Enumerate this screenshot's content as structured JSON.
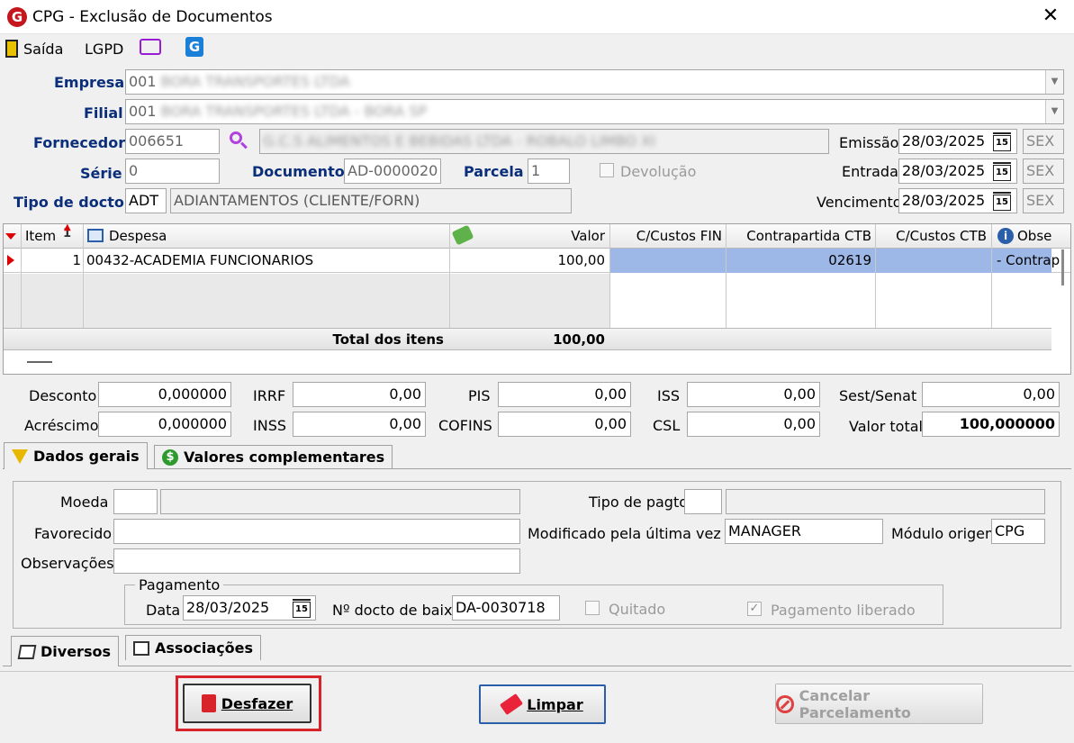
{
  "window": {
    "title": "CPG - Exclusão de Documentos"
  },
  "toolbar": {
    "exit": "Saída",
    "lgpd": "LGPD"
  },
  "header": {
    "empresa_label": "Empresa",
    "empresa_code": "001",
    "empresa_name": "BORA TRANSPORTES LTDA",
    "filial_label": "Filial",
    "filial_code": "001",
    "filial_name": "BORA TRANSPORTES LTDA - BORA SP",
    "fornecedor_label": "Fornecedor",
    "fornecedor_code": "006651",
    "fornecedor_name": "G.C.S ALIMENTOS E BEBIDAS LTDA - ROBALO LIMBO XI",
    "serie_label": "Série",
    "serie": "0",
    "documento_label": "Documento",
    "documento": "AD-0000020",
    "parcela_label": "Parcela",
    "parcela": "1",
    "devolucao_label": "Devolução",
    "tipo_label": "Tipo de docto",
    "tipo_code": "ADT",
    "tipo_desc": "ADIANTAMENTOS (CLIENTE/FORN)",
    "emissao_label": "Emissão",
    "emissao": "28/03/2025",
    "emissao_dow": "SEX",
    "entrada_label": "Entrada",
    "entrada": "28/03/2025",
    "entrada_dow": "SEX",
    "vencimento_label": "Vencimento",
    "vencimento": "28/03/2025",
    "vencimento_dow": "SEX",
    "cal_day": "15"
  },
  "grid": {
    "columns": [
      "Item",
      "Despesa",
      "Valor",
      "C/Custos FIN",
      "Contrapartida CTB",
      "C/Custos CTB",
      "Obse"
    ],
    "rows": [
      {
        "item": "1",
        "despesa": "00432-ACADEMIA FUNCIONARIOS",
        "valor": "100,00",
        "ccfin": "",
        "contrapartida": "02619",
        "ccctb": "",
        "obs": "- Contrap"
      }
    ],
    "total_label": "Total dos itens",
    "total": "100,00"
  },
  "values": {
    "desconto_label": "Desconto",
    "desconto": "0,000000",
    "acrescimo_label": "Acréscimo",
    "acrescimo": "0,000000",
    "irrf_label": "IRRF",
    "irrf": "0,00",
    "inss_label": "INSS",
    "inss": "0,00",
    "pis_label": "PIS",
    "pis": "0,00",
    "cofins_label": "COFINS",
    "cofins": "0,00",
    "iss_label": "ISS",
    "iss": "0,00",
    "csl_label": "CSL",
    "csl": "0,00",
    "sest_label": "Sest/Senat",
    "sest": "0,00",
    "total_label": "Valor total",
    "total": "100,000000"
  },
  "tabs": {
    "dados": "Dados gerais",
    "valores": "Valores complementares",
    "diversos": "Diversos",
    "associacoes": "Associações"
  },
  "details": {
    "moeda_label": "Moeda",
    "favorecido_label": "Favorecido",
    "observacoes_label": "Observações",
    "tipo_pagto_label": "Tipo de pagto",
    "modificado_label": "Modificado pela última vez por",
    "modificado": "MANAGER",
    "modulo_label": "Módulo origem",
    "modulo": "CPG",
    "pagamento_label": "Pagamento",
    "data_label": "Data",
    "data": "28/03/2025",
    "baixa_label": "Nº docto de baixa",
    "baixa": "DA-0030718",
    "quitado_label": "Quitado",
    "liberado_label": "Pagamento liberado"
  },
  "buttons": {
    "desfazer": "Desfazer",
    "limpar": "Limpar",
    "cancelar": "Cancelar Parcelamento"
  }
}
